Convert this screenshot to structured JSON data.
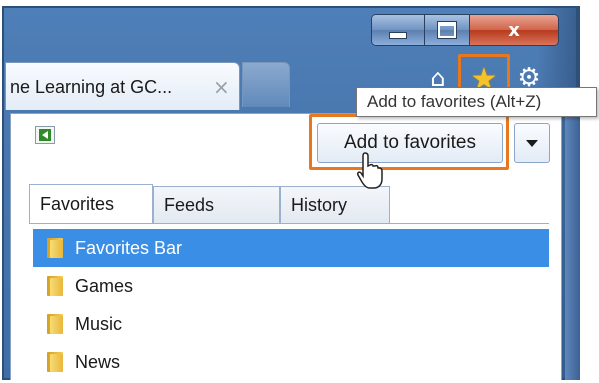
{
  "window": {
    "close_glyph": "x",
    "tab_title": "ne Learning at GC...",
    "tab_close_glyph": "×"
  },
  "toolbar": {
    "home_glyph": "⌂",
    "star_glyph": "★",
    "gear_glyph": "⚙"
  },
  "favorites_center": {
    "add_button_label": "Add to favorites",
    "tooltip": "Add to favorites (Alt+Z)",
    "tabs": [
      "Favorites",
      "Feeds",
      "History"
    ],
    "items": [
      {
        "label": "Favorites Bar",
        "selected": true
      },
      {
        "label": "Games",
        "selected": false
      },
      {
        "label": "Music",
        "selected": false
      },
      {
        "label": "News",
        "selected": false
      }
    ]
  },
  "colors": {
    "highlight": "#e8781f",
    "selection": "#3a8ee6",
    "frame": "#4876ad",
    "star": "#f6c22a"
  },
  "icons": [
    "minimize-icon",
    "maximize-icon",
    "close-icon",
    "home-icon",
    "star-icon",
    "gear-icon",
    "pin-icon",
    "dropdown-arrow-icon",
    "folder-icon",
    "cursor-icon"
  ]
}
